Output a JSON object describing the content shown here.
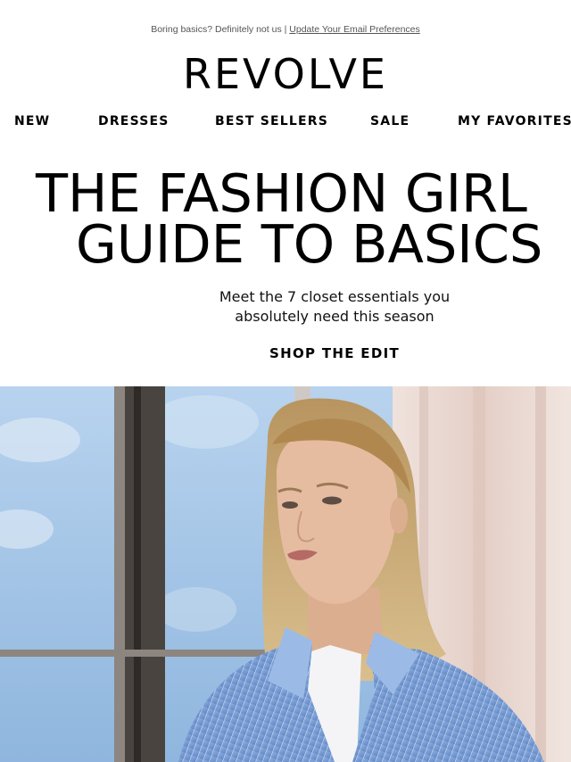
{
  "preheader": {
    "text": "Boring basics? Definitely not us | ",
    "link": "Update Your Email Preferences"
  },
  "brand": {
    "logo": "REVOLVE"
  },
  "nav": {
    "items": [
      "NEW",
      "DRESSES",
      "BEST SELLERS",
      "SALE",
      "MY FAVORITES"
    ]
  },
  "hero_text": {
    "headline_line1": "THE FASHION GIRL",
    "headline_line2": "GUIDE TO BASICS",
    "subheadline_line1": "Meet the 7 closet essentials you",
    "subheadline_line2": "absolutely need this season",
    "cta": "SHOP THE EDIT"
  },
  "hero_image": {
    "subject": "blonde-model-blue-striped-shirt-by-window",
    "colors": {
      "sky": "#a9c8e6",
      "window_frame": "#4a4440",
      "curtain": "#e9d6cf",
      "shirt": "#7ea2d6",
      "hair": "#c8a876",
      "skin": "#e3b79a"
    }
  }
}
